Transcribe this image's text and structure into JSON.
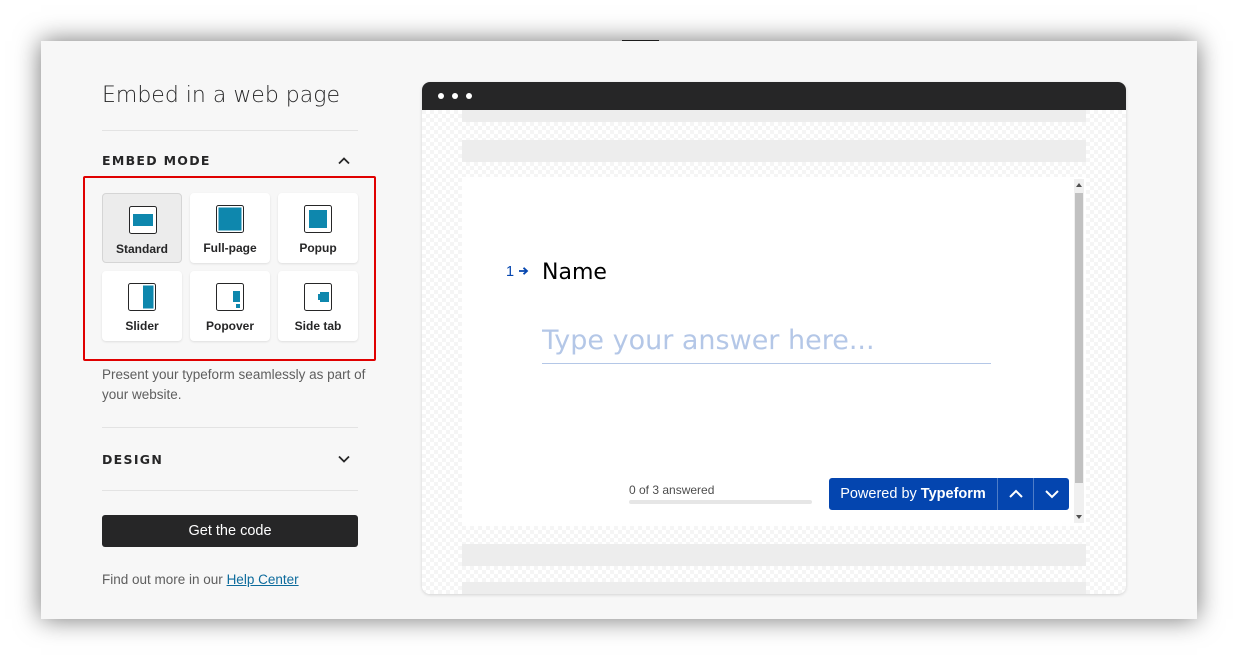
{
  "panel": {
    "title": "Embed in a web page",
    "embed_mode": {
      "label": "EMBED MODE",
      "expanded": true,
      "modes": [
        {
          "label": "Standard",
          "icon": "standard-embed-icon",
          "selected": true
        },
        {
          "label": "Full-page",
          "icon": "full-page-embed-icon",
          "selected": false
        },
        {
          "label": "Popup",
          "icon": "popup-embed-icon",
          "selected": false
        },
        {
          "label": "Slider",
          "icon": "slider-embed-icon",
          "selected": false
        },
        {
          "label": "Popover",
          "icon": "popover-embed-icon",
          "selected": false
        },
        {
          "label": "Side tab",
          "icon": "side-tab-embed-icon",
          "selected": false
        }
      ],
      "description": "Present your typeform seamlessly as part of your website."
    },
    "design": {
      "label": "DESIGN",
      "expanded": false
    },
    "get_code_label": "Get the code",
    "help_prefix": "Find out more in our ",
    "help_link": "Help Center"
  },
  "preview": {
    "question_number": "1",
    "question_title": "Name",
    "answer_placeholder": "Type your answer here...",
    "progress_text": "0 of 3 answered",
    "progress_fraction": 0,
    "powered_prefix": "Powered by ",
    "powered_brand": "Typeform"
  },
  "colors": {
    "accent": "#0445af",
    "embed_icon": "#0e87ad",
    "highlight": "#e00000",
    "dark": "#262627"
  }
}
